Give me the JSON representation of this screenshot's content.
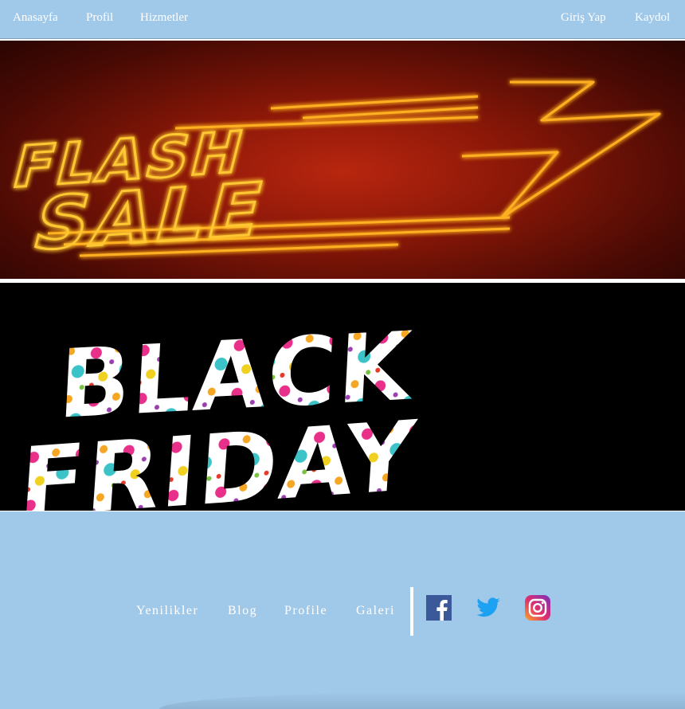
{
  "nav": {
    "left": [
      "Anasayfa",
      "Profil",
      "Hizmetler"
    ],
    "right": [
      "Giriş Yap",
      "Kaydol"
    ]
  },
  "banners": {
    "flash": {
      "line1": "FLASH",
      "line2": "SALE"
    },
    "black": {
      "line1": "BLACK",
      "line2": "FRIDAY"
    }
  },
  "footer": {
    "links": [
      "Yenilikler",
      "Blog",
      "Profile",
      "Galeri"
    ],
    "social_icons": [
      "facebook-icon",
      "twitter-icon",
      "instagram-icon"
    ]
  },
  "colors": {
    "nav_bg": "#a0c8e8",
    "footer_bg": "#a0c8e8",
    "neon": "#ffb020",
    "facebook": "#3b5998",
    "twitter": "#1da1f2"
  }
}
